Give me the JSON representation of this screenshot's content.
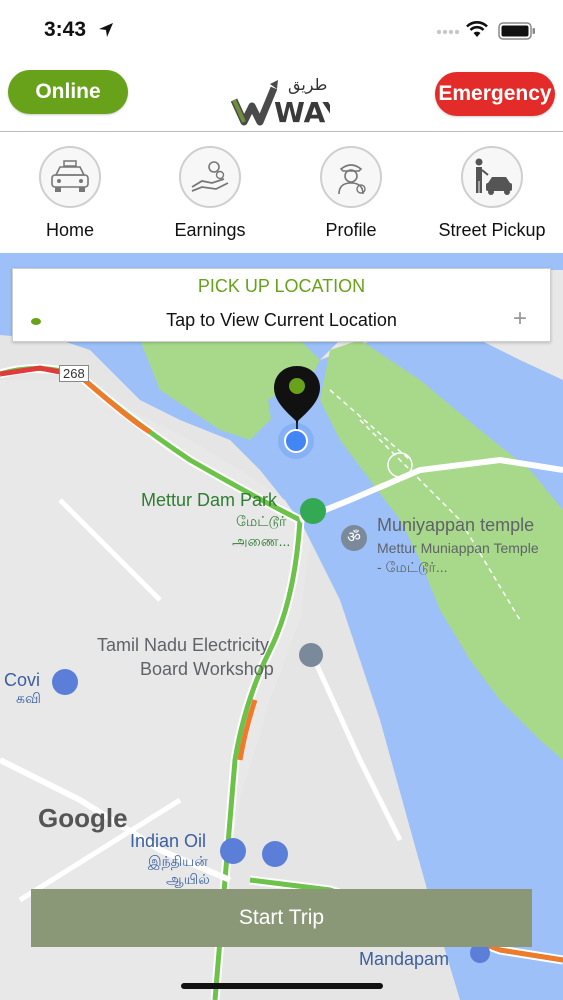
{
  "status_bar": {
    "time": "3:43"
  },
  "header": {
    "online_label": "Online",
    "emergency_label": "Emergency",
    "logo_arabic": "طريق",
    "logo_latin": "WAY"
  },
  "nav": {
    "items": [
      {
        "label": "Home",
        "icon": "taxi-icon"
      },
      {
        "label": "Earnings",
        "icon": "earnings-icon"
      },
      {
        "label": "Profile",
        "icon": "driver-profile-icon"
      },
      {
        "label": "Street Pickup",
        "icon": "street-pickup-icon"
      }
    ]
  },
  "pickup": {
    "title": "PICK UP LOCATION",
    "text": "Tap to View Current Location",
    "plus": "+"
  },
  "map": {
    "route_badge": "268",
    "labels": {
      "park": "Mettur Dam Park",
      "park_tamil_1": "மேட்டூர்",
      "park_tamil_2": "அணை...",
      "temple": "Muniyappan temple",
      "temple_sub_1": "Mettur Muniappan Temple",
      "temple_sub_2": "- மேட்டூர்...",
      "board_1": "Tamil Nadu Electricity",
      "board_2": "Board Workshop",
      "covi": "Covi",
      "covi_tamil": "கவி",
      "indian_oil": "Indian Oil",
      "indian_oil_tamil_1": "இந்தியன்",
      "indian_oil_tamil_2": "ஆயில்",
      "mandapam": "Mandapam",
      "google": "Google"
    }
  },
  "start_trip_label": "Start Trip",
  "colors": {
    "online": "#67a21a",
    "emergency": "#e32b29",
    "start_trip": "#8a9878",
    "pickup_title": "#67a21a"
  }
}
